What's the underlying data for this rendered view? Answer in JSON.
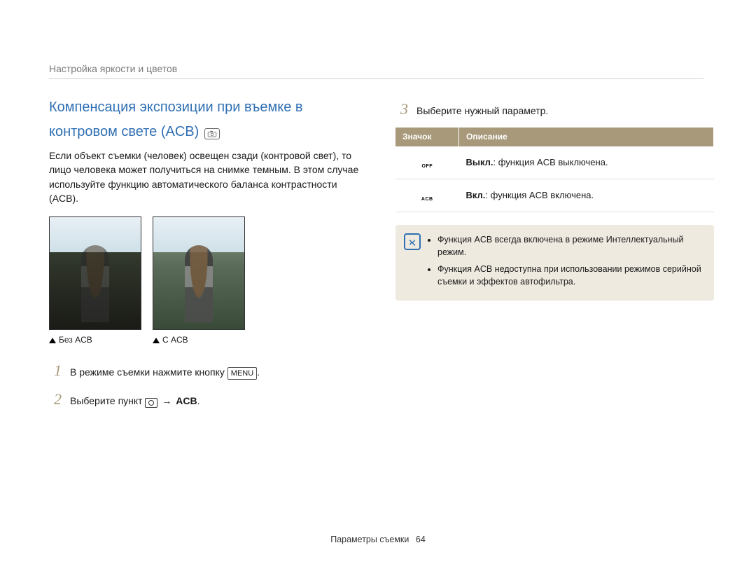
{
  "breadcrumb": "Настройка яркости и цветов",
  "section_title_line1": "Компенсация экспозиции при въемке в",
  "section_title_line2": "контровом свете (ACB)",
  "mode_icon": "camera-mode",
  "intro_paragraph": "Если объект съемки (человек) освещен сзади (контровой свет), то лицо человека может получиться на снимке темным. В этом случае используйте функцию автоматического баланса контрастности (ACB).",
  "caption_without": "Без ACB",
  "caption_with": "С ACB",
  "steps": [
    {
      "num": "1",
      "pre": "В режиме съемки нажмите кнопку ",
      "key": "MENU",
      "post": "."
    },
    {
      "num": "2",
      "pre": "Выберите пункт ",
      "after_icon": " → ",
      "bold": "ACB",
      "post": "."
    }
  ],
  "step3": {
    "num": "3",
    "text": "Выберите нужный параметр."
  },
  "table": {
    "head_icon": "Значок",
    "head_desc": "Описание",
    "rows": [
      {
        "icon_label": "OFF",
        "bold": "Выкл.",
        "rest": ": функция ACB выключена."
      },
      {
        "icon_label": "ACB",
        "bold": "Вкл.",
        "rest": ": функция ACB включена."
      }
    ]
  },
  "notes": [
    "Функция ACB всегда включена в режиме Интеллектуальный режим.",
    "Функция ACB недоступна при использовании режимов серийной съемки и эффектов автофильтра."
  ],
  "footer_label": "Параметры съемки",
  "footer_page": "64"
}
